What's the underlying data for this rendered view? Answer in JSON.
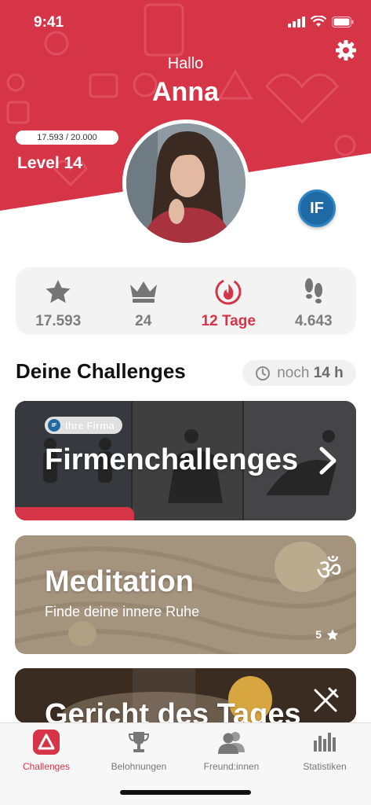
{
  "status_bar": {
    "time": "9:41"
  },
  "header": {
    "greeting": "Hallo",
    "user_name": "Anna",
    "xp_text": "17.593 / 20.000",
    "xp_progress": 0.88,
    "level_label": "Level 14",
    "company_badge": "IF",
    "brand_color": "#d63447"
  },
  "stats": [
    {
      "icon": "star-icon",
      "value": "17.593"
    },
    {
      "icon": "crown-icon",
      "value": "24"
    },
    {
      "icon": "flame-icon",
      "value": "12 Tage",
      "active": true
    },
    {
      "icon": "footsteps-icon",
      "value": "4.643"
    }
  ],
  "challenges": {
    "section_title": "Deine Challenges",
    "timer_prefix": "noch",
    "timer_value": "14 h",
    "cards": [
      {
        "badge": "Ihre Firma",
        "badge_logo": "IF",
        "title": "Firmenchallenges",
        "progress": 0.35
      },
      {
        "title": "Meditation",
        "subtitle": "Finde deine innere Ruhe",
        "rating": "5",
        "icon": "om-icon"
      },
      {
        "title": "Gericht des Tages",
        "icon": "fork-knife-icon"
      }
    ]
  },
  "tabbar": {
    "items": [
      {
        "label": "Challenges",
        "icon": "challenges-icon",
        "active": true
      },
      {
        "label": "Belohnungen",
        "icon": "trophy-icon"
      },
      {
        "label": "Freund:innen",
        "icon": "friends-icon"
      },
      {
        "label": "Statistiken",
        "icon": "statistics-icon"
      }
    ]
  }
}
